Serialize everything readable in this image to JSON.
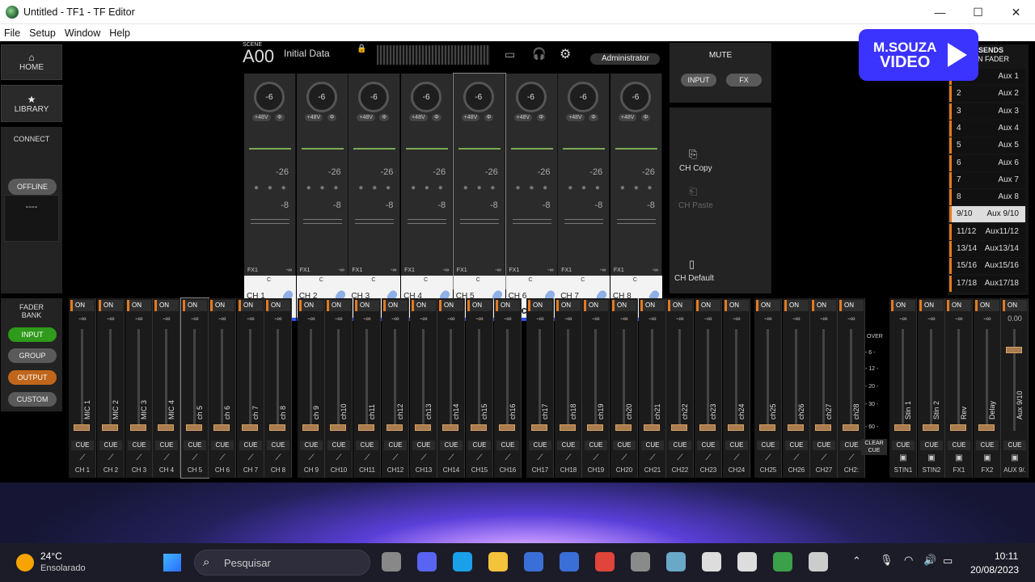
{
  "window": {
    "title": "Untitled - TF1 - TF Editor",
    "minimize": "—",
    "maximize": "☐",
    "close": "✕"
  },
  "menu": [
    "File",
    "Setup",
    "Window",
    "Help"
  ],
  "left": {
    "home": "HOME",
    "library": "LIBRARY",
    "connect": "CONNECT",
    "offline": "OFFLINE",
    "status": "----",
    "fader_bank": "FADER",
    "bank": "BANK",
    "input": "INPUT",
    "group": "GROUP",
    "output": "OUTPUT",
    "custom": "CUSTOM"
  },
  "scene": {
    "label": "SCENE",
    "number": "A00",
    "name": "Initial Data",
    "user": "Administrator"
  },
  "mute": {
    "title": "MUTE",
    "input": "INPUT",
    "fx": "FX"
  },
  "ch_actions": {
    "copy": "CH Copy",
    "paste": "CH Paste",
    "default": "CH Default"
  },
  "strips": [
    {
      "ch": "CH 1",
      "name": "MIC 1"
    },
    {
      "ch": "CH 2",
      "name": "MIC 2"
    },
    {
      "ch": "CH 3",
      "name": "MIC 3"
    },
    {
      "ch": "CH 4",
      "name": "MIC 4"
    },
    {
      "ch": "CH 5",
      "name": "ch 5"
    },
    {
      "ch": "CH 6",
      "name": "ch 6"
    },
    {
      "ch": "CH 7",
      "name": "ch 7"
    },
    {
      "ch": "CH 8",
      "name": "ch 8"
    }
  ],
  "strip_common": {
    "gain": "-6",
    "phantom": "+48V",
    "phase": "Φ",
    "v1": "-26",
    "v2": "-8",
    "fx1": "FX1",
    "inf": "-∞",
    "pan": "C"
  },
  "sends": {
    "title": "SENDS",
    "sub": "ON FADER",
    "rows": [
      {
        "n": "1",
        "l": "Aux 1"
      },
      {
        "n": "2",
        "l": "Aux 2"
      },
      {
        "n": "3",
        "l": "Aux 3"
      },
      {
        "n": "4",
        "l": "Aux 4"
      },
      {
        "n": "5",
        "l": "Aux 5"
      },
      {
        "n": "6",
        "l": "Aux 6"
      },
      {
        "n": "7",
        "l": "Aux 7"
      },
      {
        "n": "8",
        "l": "Aux 8"
      },
      {
        "n": "9/10",
        "l": "Aux 9/10"
      },
      {
        "n": "11/12",
        "l": "Aux11/12"
      },
      {
        "n": "13/14",
        "l": "Aux13/14"
      },
      {
        "n": "15/16",
        "l": "Aux15/16"
      },
      {
        "n": "17/18",
        "l": "Aux17/18"
      }
    ]
  },
  "faders": [
    {
      "label": "MIC 1",
      "ch": "CH 1"
    },
    {
      "label": "MIC 2",
      "ch": "CH 2"
    },
    {
      "label": "MIC 3",
      "ch": "CH 3"
    },
    {
      "label": "MIC 4",
      "ch": "CH 4"
    },
    {
      "label": "ch 5",
      "ch": "CH 5"
    },
    {
      "label": "ch 6",
      "ch": "CH 6"
    },
    {
      "label": "ch 7",
      "ch": "CH 7"
    },
    {
      "label": "ch 8",
      "ch": "CH 8"
    },
    {
      "label": "ch 9",
      "ch": "CH 9"
    },
    {
      "label": "ch10",
      "ch": "CH10"
    },
    {
      "label": "ch11",
      "ch": "CH11"
    },
    {
      "label": "ch12",
      "ch": "CH12"
    },
    {
      "label": "ch13",
      "ch": "CH13"
    },
    {
      "label": "ch14",
      "ch": "CH14"
    },
    {
      "label": "ch15",
      "ch": "CH15"
    },
    {
      "label": "ch16",
      "ch": "CH16"
    },
    {
      "label": "ch17",
      "ch": "CH17"
    },
    {
      "label": "ch18",
      "ch": "CH18"
    },
    {
      "label": "ch19",
      "ch": "CH19"
    },
    {
      "label": "ch20",
      "ch": "CH20"
    },
    {
      "label": "ch21",
      "ch": "CH21"
    },
    {
      "label": "ch22",
      "ch": "CH22"
    },
    {
      "label": "ch23",
      "ch": "CH23"
    },
    {
      "label": "ch24",
      "ch": "CH24"
    },
    {
      "label": "ch25",
      "ch": "CH25"
    },
    {
      "label": "ch26",
      "ch": "CH26"
    },
    {
      "label": "ch27",
      "ch": "CH27"
    },
    {
      "label": "ch28",
      "ch": "CH2:"
    }
  ],
  "fader_common": {
    "on": "ON",
    "inf": "-∞",
    "cue": "CUE"
  },
  "meter": {
    "over": "OVER",
    "marks": [
      "- 6 -",
      "- 12 -",
      "- 20 -",
      "- 30 -",
      "- 60 -"
    ],
    "clear": "CLEAR",
    "cue": "CUE"
  },
  "right_faders": [
    {
      "label": "Stin 1",
      "ch": "STIN1",
      "val": "-∞"
    },
    {
      "label": "Stin 2",
      "ch": "STIN2",
      "val": "-∞"
    },
    {
      "label": "Rev",
      "ch": "FX1",
      "val": "-∞"
    },
    {
      "label": "Delay",
      "ch": "FX2",
      "val": "-∞"
    },
    {
      "label": "Aux 9/10",
      "ch": "AUX 9/.",
      "val": "0.00"
    }
  ],
  "watermark": {
    "line1": "M.SOUZA",
    "line2": "VIDEO"
  },
  "taskbar": {
    "temp": "24°C",
    "weather": "Ensolarado",
    "search": "Pesquisar",
    "time": "10:11",
    "date": "20/08/2023"
  }
}
